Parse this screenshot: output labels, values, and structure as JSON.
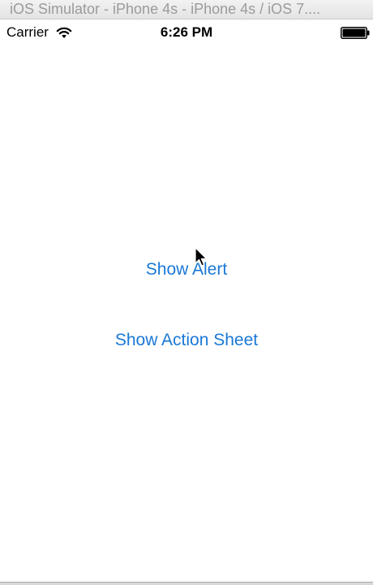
{
  "window": {
    "title": "iOS Simulator - iPhone 4s - iPhone 4s / iOS 7...."
  },
  "status_bar": {
    "carrier": "Carrier",
    "time": "6:26 PM",
    "icons": [
      "wifi-icon",
      "battery-icon"
    ]
  },
  "main": {
    "show_alert_label": "Show Alert",
    "show_action_sheet_label": "Show Action Sheet"
  },
  "colors": {
    "accent": "#1a78d6",
    "title_text": "#9b9b9b"
  }
}
